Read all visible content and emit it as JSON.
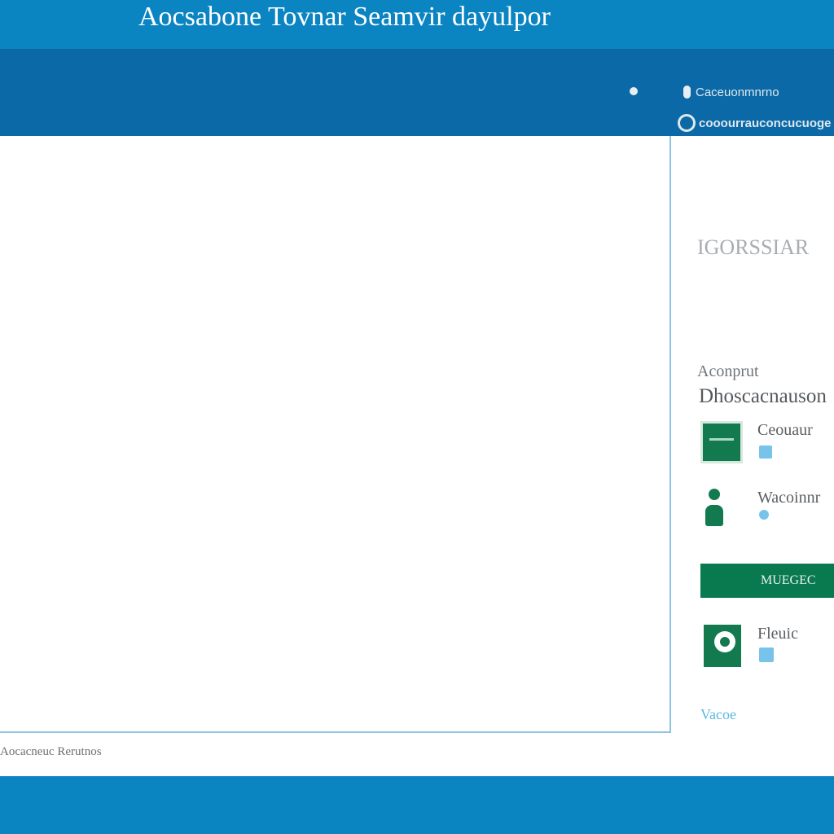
{
  "window": {
    "title": "Aocsabone Tovnar Seamvir dayulpor"
  },
  "header": {
    "account_label": "Caceuonmnrno",
    "account_secondary_label": "cooourrauconcucuoge"
  },
  "side_panel": {
    "heading": "IGORSSIAR",
    "subheading": "Aconprut",
    "section_title": "Dhoscacnauson",
    "items": [
      {
        "label": "Ceouaur",
        "icon": "grid-icon"
      },
      {
        "label": "Wacoinnr",
        "icon": "user-icon"
      }
    ],
    "manage_button_label": "MUEGEC",
    "file_item": {
      "label": "Fleuic",
      "icon": "file-icon"
    },
    "link_label": "Vacoe"
  },
  "footer": {
    "status_text": "Aocacneuc Rerutnos"
  },
  "colors": {
    "title_bar": "#0b84c2",
    "header_bar": "#0a69a6",
    "accent_green": "#137a4f",
    "link_blue": "#5db8e2"
  }
}
